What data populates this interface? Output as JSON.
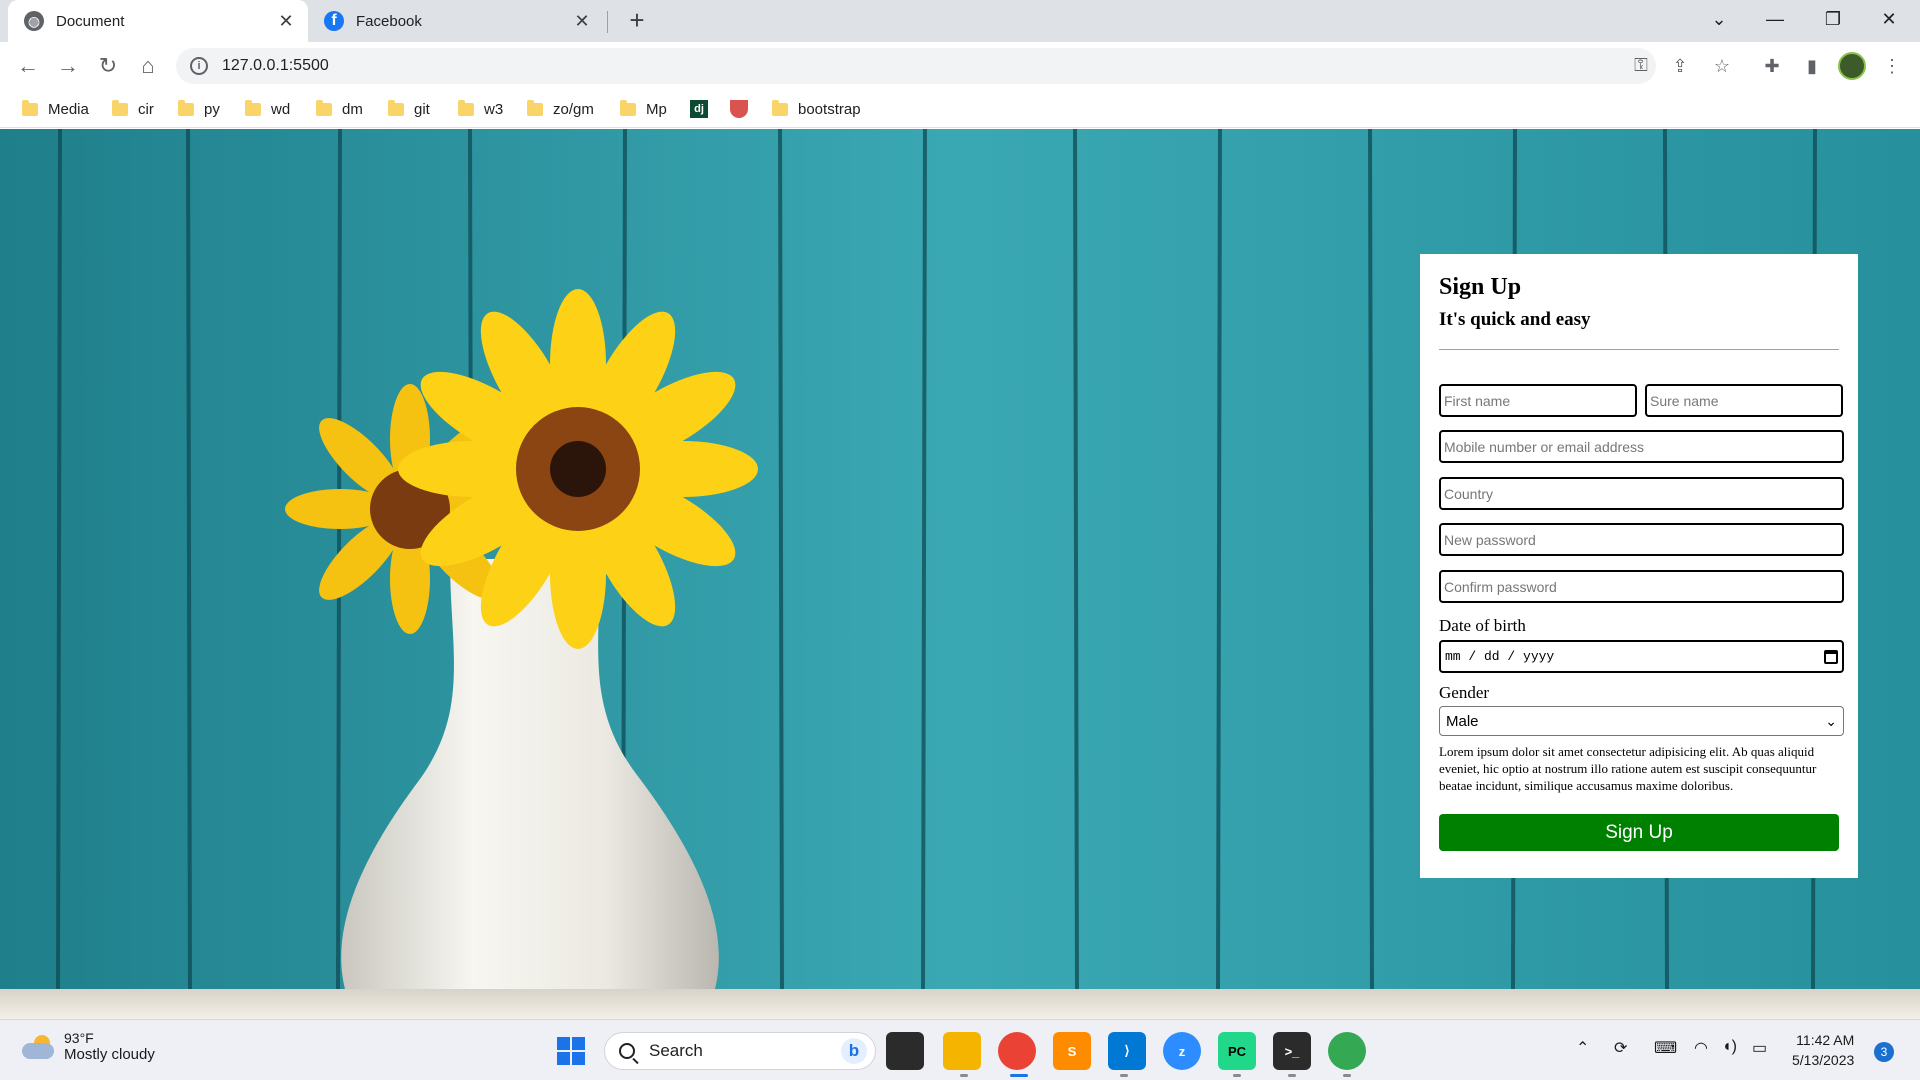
{
  "browser": {
    "tabs": [
      {
        "title": "Document",
        "icon": "globe-icon",
        "active": true
      },
      {
        "title": "Facebook",
        "icon": "facebook-icon",
        "active": false
      }
    ],
    "new_tab_label": "+",
    "address": "127.0.0.1:5500",
    "bookmarks": [
      {
        "label": "Media",
        "icon": "folder-icon"
      },
      {
        "label": "cir",
        "icon": "folder-icon"
      },
      {
        "label": "py",
        "icon": "folder-icon"
      },
      {
        "label": "wd",
        "icon": "folder-icon"
      },
      {
        "label": "dm",
        "icon": "folder-icon"
      },
      {
        "label": "git",
        "icon": "folder-icon"
      },
      {
        "label": "w3",
        "icon": "folder-icon"
      },
      {
        "label": "zo/gm",
        "icon": "folder-icon"
      },
      {
        "label": "Mp",
        "icon": "folder-icon"
      },
      {
        "label": "dj",
        "icon": "django-icon"
      },
      {
        "label": "",
        "icon": "shield-icon"
      },
      {
        "label": "bootstrap",
        "icon": "folder-icon"
      }
    ]
  },
  "signup": {
    "title": "Sign Up",
    "subtitle": "It's quick and easy",
    "first_name_placeholder": "First name",
    "surname_placeholder": "Sure name",
    "contact_placeholder": "Mobile number or email address",
    "country_placeholder": "Country",
    "new_password_placeholder": "New password",
    "confirm_password_placeholder": "Confirm password",
    "dob_label": "Date of birth",
    "dob_value": "mm / dd / yyyy",
    "gender_label": "Gender",
    "gender_value": "Male",
    "terms_text": "Lorem ipsum dolor sit amet consectetur adipisicing elit. Ab quas aliquid eveniet, hic optio at nostrum illo ratione autem est suscipit consequuntur beatae incidunt, similique accusamus maxime doloribus.",
    "submit_label": "Sign Up",
    "submit_color": "#008000"
  },
  "taskbar": {
    "weather_temp": "93°F",
    "weather_desc": "Mostly cloudy",
    "search_placeholder": "Search",
    "time": "11:42 AM",
    "date": "5/13/2023",
    "notification_count": "3",
    "apps": [
      "start-icon",
      "task-view-icon",
      "file-explorer-icon",
      "chrome-icon",
      "sublime-text-icon",
      "vscode-icon",
      "zoom-icon",
      "pycharm-icon",
      "terminal-icon",
      "chrome-icon"
    ]
  }
}
